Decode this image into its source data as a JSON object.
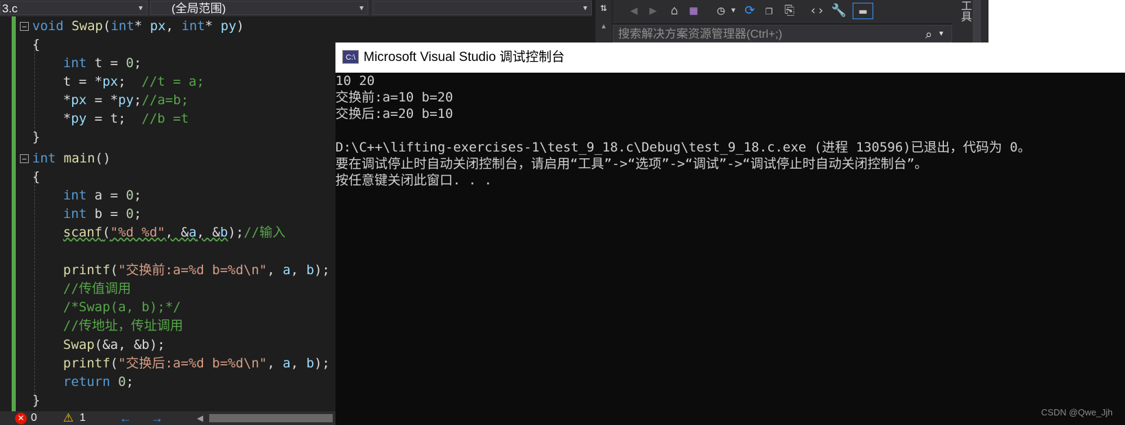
{
  "editor": {
    "file_tab_fragment": "3.c",
    "scope_dropdown": "(全局范围)",
    "member_dropdown": "",
    "code": {
      "l1": {
        "kw1": "void",
        "fn": "Swap",
        "p1": "(",
        "kw2": "int",
        "p2": "* ",
        "var1": "px",
        "p3": ", ",
        "kw3": "int",
        "p4": "* ",
        "var2": "py",
        "p5": ")"
      },
      "l2": "{",
      "l3": {
        "kw": "int",
        "rest": " t = ",
        "num": "0",
        "end": ";"
      },
      "l4": {
        "a": "t = *",
        "var": "px",
        "b": ";  ",
        "cm": "//t = a;"
      },
      "l5": {
        "a": "*",
        "var1": "px",
        "b": " = *",
        "var2": "py",
        "c": ";",
        "cm": "//a=b;"
      },
      "l6": {
        "a": "*",
        "var": "py",
        "b": " = t;  ",
        "cm": "//b =t"
      },
      "l7": "}",
      "l8": {
        "kw": "int",
        "fn": "main",
        "rest": "()"
      },
      "l9": "{",
      "l10": {
        "kw": "int",
        "rest": " a = ",
        "num": "0",
        "end": ";"
      },
      "l11": {
        "kw": "int",
        "rest": " b = ",
        "num": "0",
        "end": ";"
      },
      "l12": {
        "fn": "scanf",
        "p1": "(",
        "str": "\"%d %d\"",
        "p2": ", &",
        "v1": "a",
        "p3": ", &",
        "v2": "b",
        "p4": ");",
        "cm": "//输入"
      },
      "l14": {
        "fn": "printf",
        "p1": "(",
        "str": "\"交换前:a=%d b=%d\\n\"",
        "p2": ", ",
        "v1": "a",
        "p3": ", ",
        "v2": "b",
        "p4": ");"
      },
      "l15": "//传值调用",
      "l16": "/*Swap(a, b);*/",
      "l17": "//传地址，传址调用",
      "l18": {
        "fn": "Swap",
        "rest": "(&a, &b);"
      },
      "l19": {
        "fn": "printf",
        "p1": "(",
        "str": "\"交换后:a=%d b=%d\\n\"",
        "p2": ", ",
        "v1": "a",
        "p3": ", ",
        "v2": "b",
        "p4": ");"
      },
      "l20": {
        "kw": "return",
        "rest": " ",
        "num": "0",
        "end": ";"
      },
      "l21": "}"
    },
    "status": {
      "errors": "0",
      "warnings": "1"
    }
  },
  "solution_explorer": {
    "search_placeholder": "搜索解决方案资源管理器(Ctrl+;)",
    "side_label": "工具"
  },
  "console": {
    "title": "Microsoft Visual Studio 调试控制台",
    "icon_text": "C:\\",
    "lines": [
      "10 20",
      "交换前:a=10 b=20",
      "交换后:a=20 b=10",
      "",
      "D:\\C++\\lifting-exercises-1\\test_9_18.c\\Debug\\test_9_18.c.exe (进程 130596)已退出，代码为 0。",
      "要在调试停止时自动关闭控制台，请启用“工具”->“选项”->“调试”->“调试停止时自动关闭控制台”。",
      "按任意键关闭此窗口. . ."
    ]
  },
  "watermark": "CSDN @Qwe_Jjh",
  "colors": {
    "keyword": "#569cd6",
    "function": "#dcdcaa",
    "variable": "#9cdcfe",
    "comment": "#57a64a",
    "string": "#d69d85"
  }
}
